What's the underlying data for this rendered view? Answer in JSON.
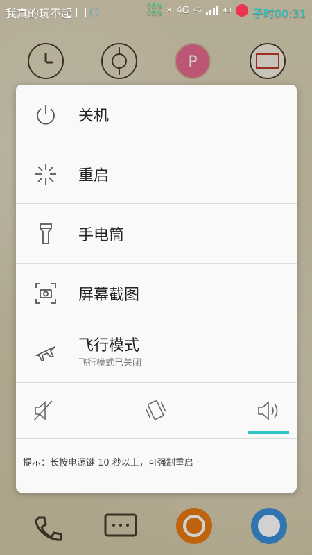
{
  "status_bar": {
    "title": "我真的玩不起",
    "net_up": "0B/s",
    "net_down": "0B/s",
    "net1": "4G",
    "net2": "4G",
    "battery": "43",
    "time": "子时00:31"
  },
  "menu": {
    "items": [
      {
        "label": "关机",
        "icon": "power-icon"
      },
      {
        "label": "重启",
        "icon": "restart-icon"
      },
      {
        "label": "手电筒",
        "icon": "flashlight-icon"
      },
      {
        "label": "屏幕截图",
        "icon": "screenshot-icon"
      },
      {
        "label": "飞行模式",
        "sublabel": "飞行模式已关闭",
        "icon": "airplane-icon"
      }
    ],
    "sound_modes": [
      "mute-icon",
      "vibrate-icon",
      "sound-on-icon"
    ],
    "active_sound_mode": "sound-on-icon",
    "hint": "提示：长按电源键 10 秒以上，可强制重启"
  },
  "colors": {
    "accent": "#2ec4c4",
    "panel_bg": "#f9f9f9",
    "time_color": "#27c6c6"
  }
}
